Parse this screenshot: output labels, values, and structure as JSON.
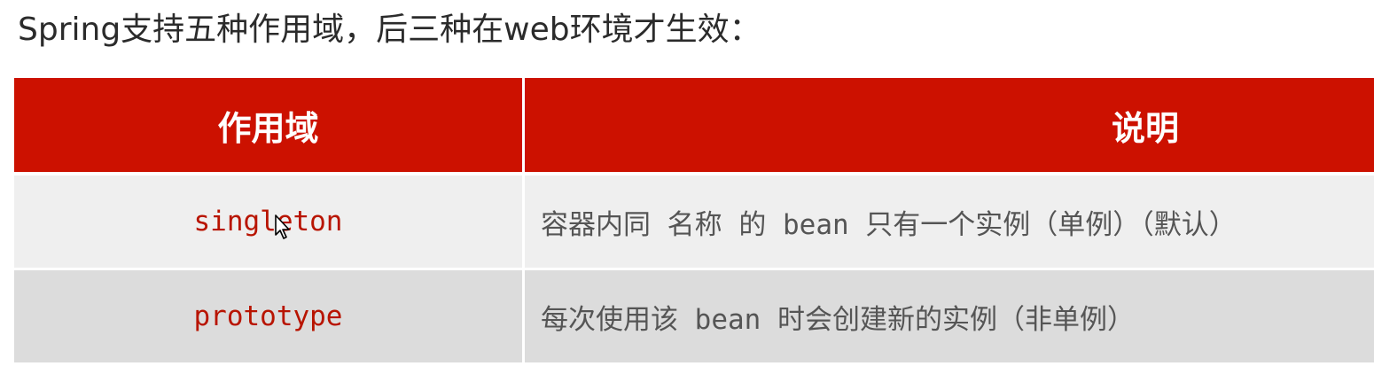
{
  "intro_text": "Spring支持五种作用域，后三种在web环境才生效：",
  "table": {
    "headers": {
      "scope": "作用域",
      "description": "说明"
    },
    "rows": [
      {
        "scope": "singleton",
        "description": "容器内同 名称 的 bean 只有一个实例（单例）（默认）"
      },
      {
        "scope": "prototype",
        "description": "每次使用该 bean 时会创建新的实例（非单例）"
      }
    ]
  },
  "colors": {
    "header_background": "#cc1100",
    "header_text": "#ffffff",
    "scope_text": "#b81400",
    "row_odd_background": "#efefef",
    "row_even_background": "#dcdcdc"
  },
  "icons": {
    "cursor": "mouse-pointer-icon"
  }
}
